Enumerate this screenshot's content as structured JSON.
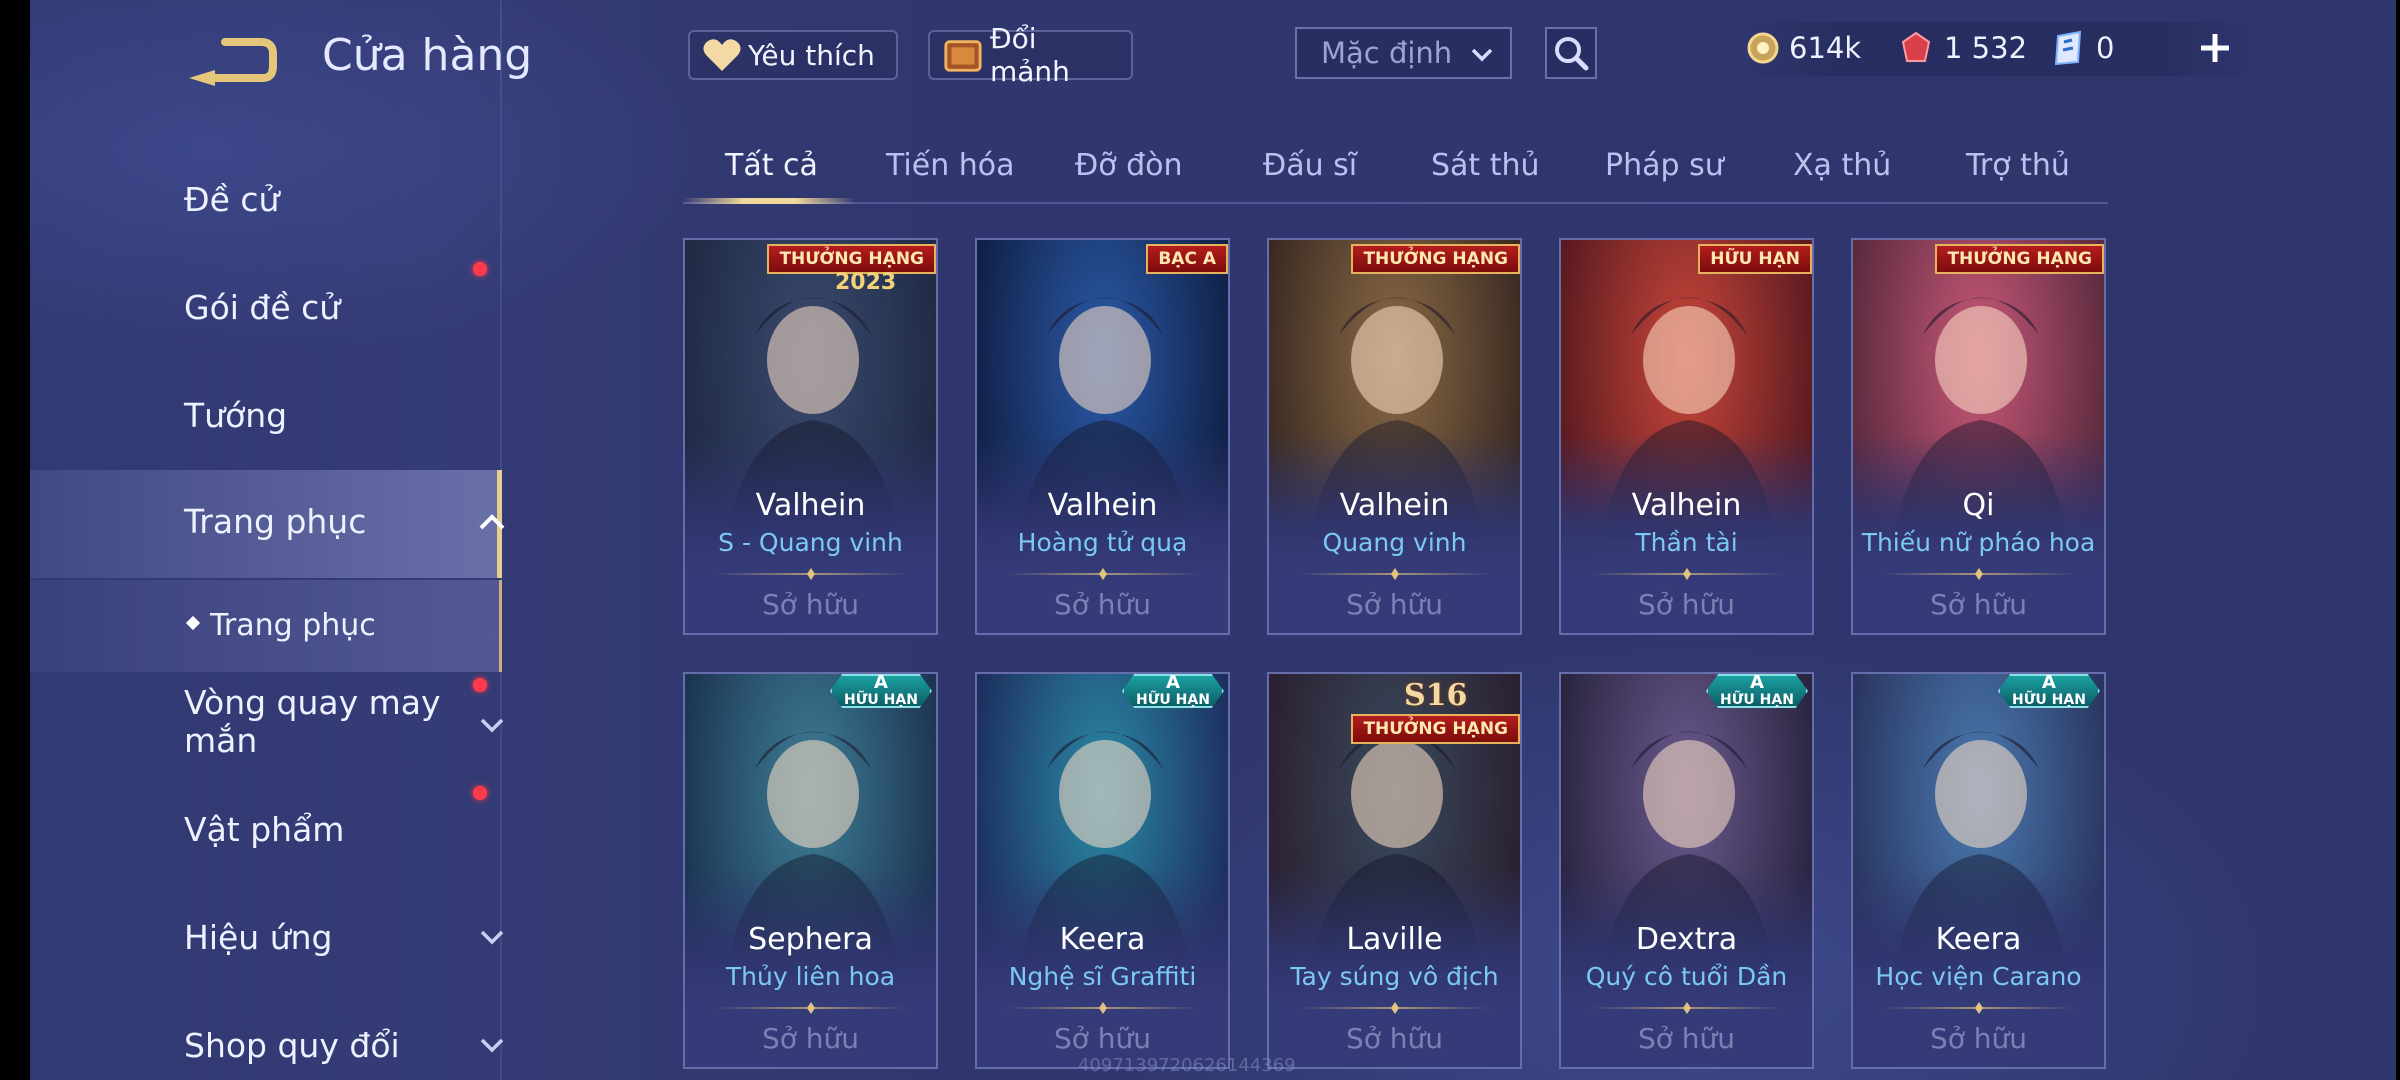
{
  "header": {
    "title": "Cửa hàng",
    "favorite_label": "Yêu thích",
    "exchange_label": "Đổi mảnh",
    "sort_selected": "Mặc định"
  },
  "currency": {
    "gold": "614k",
    "rubies": "1 532",
    "vouchers": "0"
  },
  "sidebar": {
    "items": [
      {
        "label": "Đề cử"
      },
      {
        "label": "Gói đề cử"
      },
      {
        "label": "Tướng"
      },
      {
        "label": "Trang phục"
      },
      {
        "label": "Trang phục"
      },
      {
        "label": "Vòng quay may mắn"
      },
      {
        "label": "Vật phẩm"
      },
      {
        "label": "Hiệu ứng"
      },
      {
        "label": "Shop quy đổi"
      }
    ]
  },
  "tabs": [
    "Tất cả",
    "Tiến hóa",
    "Đỡ đòn",
    "Đấu sĩ",
    "Sát thủ",
    "Pháp sư",
    "Xạ thủ",
    "Trợ thủ"
  ],
  "cards": [
    {
      "hero": "Valhein",
      "skin": "S - Quang vinh",
      "status": "Sở hữu",
      "badge": "THƯỞNG HẠNG",
      "badge_year": "2023",
      "color_a": "#3a4a6e",
      "color_b": "#1f2a44"
    },
    {
      "hero": "Valhein",
      "skin": "Hoàng tử quạ",
      "status": "Sở hữu",
      "badge": "BẠC A",
      "color_a": "#2b5aa8",
      "color_b": "#102046"
    },
    {
      "hero": "Valhein",
      "skin": "Quang vinh",
      "status": "Sở hữu",
      "badge": "THƯỞNG HẠNG",
      "color_a": "#8a6a46",
      "color_b": "#3a2a22"
    },
    {
      "hero": "Valhein",
      "skin": "Thần tài",
      "status": "Sở hữu",
      "badge": "HỮU HẠN",
      "color_a": "#c8463a",
      "color_b": "#5a1a20"
    },
    {
      "hero": "Qi",
      "skin": "Thiếu nữ pháo hoa",
      "status": "Sở hữu",
      "badge": "THƯỞNG HẠNG",
      "color_a": "#c85878",
      "color_b": "#5a2a3e"
    },
    {
      "hero": "Sephera",
      "skin": "Thủy liên hoa",
      "status": "Sở hữu",
      "badge_tier": "A",
      "badge_sub": "HỮU HẠN",
      "color_a": "#3e7e96",
      "color_b": "#1c3452"
    },
    {
      "hero": "Keera",
      "skin": "Nghệ sĩ Graffiti",
      "status": "Sở hữu",
      "badge_tier": "A",
      "badge_sub": "HỮU HẠN",
      "color_a": "#2a8aa6",
      "color_b": "#1d2e5e"
    },
    {
      "hero": "Laville",
      "skin": "Tay súng vô địch",
      "status": "Sở hữu",
      "badge": "THƯỞNG HẠNG",
      "badge_season": "S16",
      "color_a": "#3a4a5e",
      "color_b": "#2a2030"
    },
    {
      "hero": "Dextra",
      "skin": "Quý cô tuổi Dần",
      "status": "Sở hữu",
      "badge_tier": "A",
      "badge_sub": "HỮU HẠN",
      "color_a": "#6a5a8e",
      "color_b": "#2a2440"
    },
    {
      "hero": "Keera",
      "skin": "Học viện Carano",
      "status": "Sở hữu",
      "badge_tier": "A",
      "badge_sub": "HỮU HẠN",
      "color_a": "#4a7ab0",
      "color_b": "#2a3560"
    }
  ],
  "watermark": "4097139720626144369"
}
